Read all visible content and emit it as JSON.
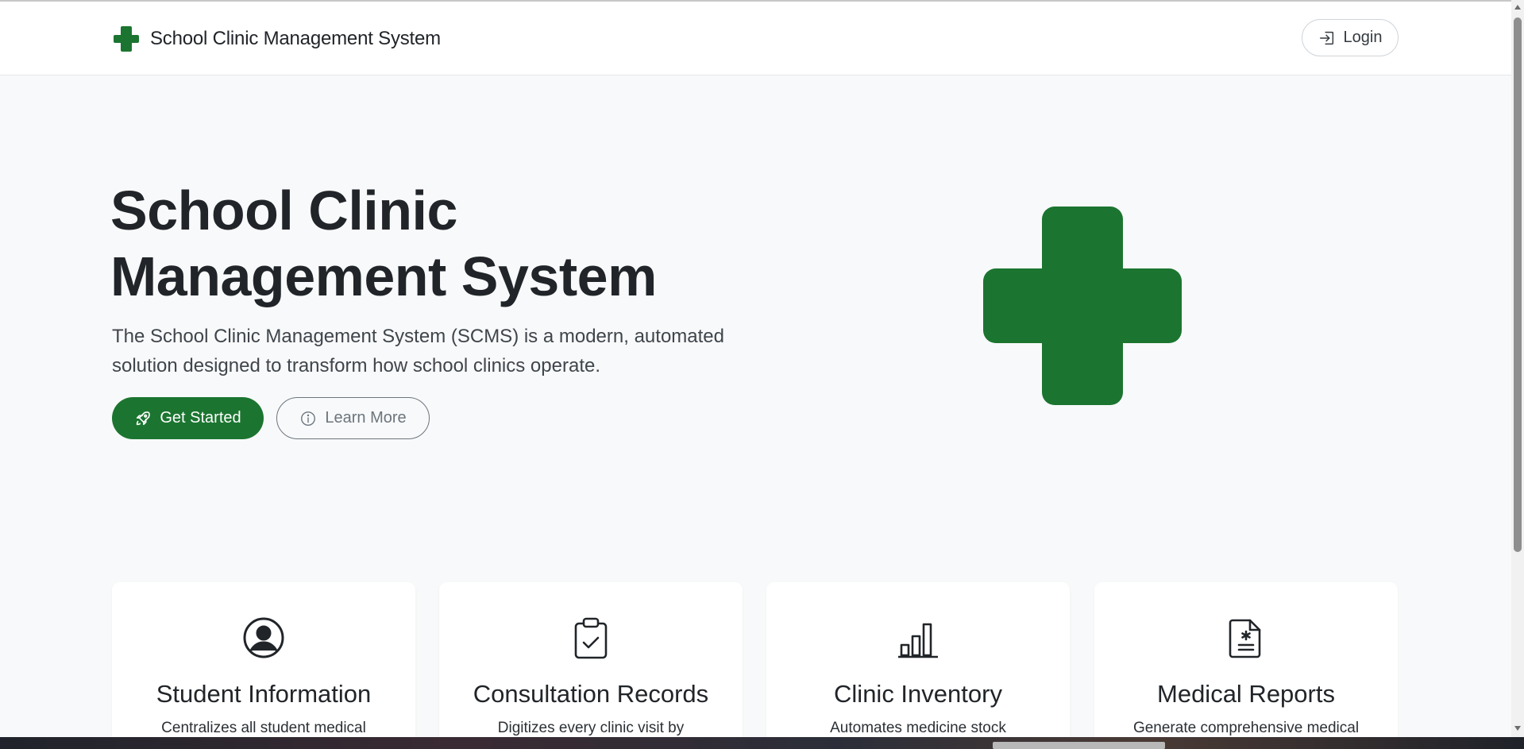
{
  "nav": {
    "brand": "School Clinic Management System",
    "login_label": "Login"
  },
  "hero": {
    "title_line1": "School Clinic",
    "title_line2": "Management System",
    "subtitle": "The School Clinic Management System (SCMS) is a modern, automated solution designed to transform how school clinics operate.",
    "primary_button": "Get Started",
    "secondary_button": "Learn More"
  },
  "features": [
    {
      "title": "Student Information",
      "desc": "Centralizes all student medical",
      "icon": "person-circle-icon"
    },
    {
      "title": "Consultation Records",
      "desc": "Digitizes every clinic visit by",
      "icon": "clipboard-check-icon"
    },
    {
      "title": "Clinic Inventory",
      "desc": "Automates medicine stock",
      "icon": "bar-chart-icon"
    },
    {
      "title": "Medical Reports",
      "desc": "Generate comprehensive medical",
      "icon": "file-medical-icon"
    }
  ],
  "colors": {
    "brand_green": "#1b7530",
    "page_bg": "#f8f9fa",
    "text_dark": "#212529"
  }
}
